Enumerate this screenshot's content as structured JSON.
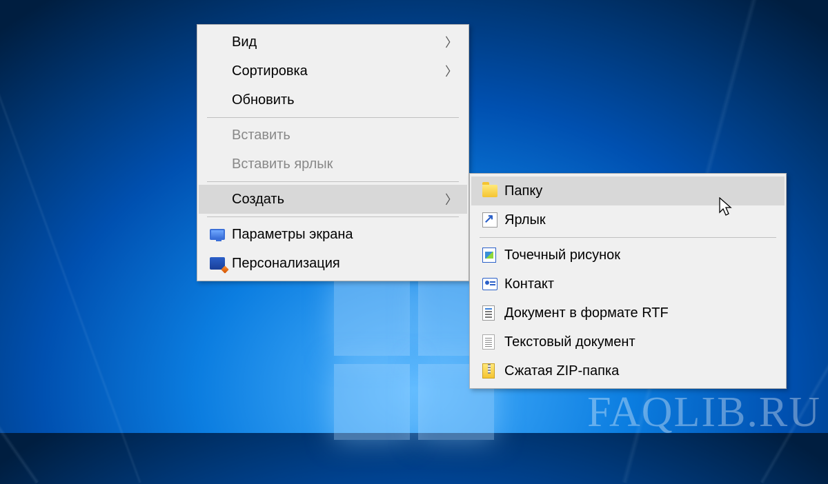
{
  "watermark": "FAQLIB.RU",
  "context_menu": {
    "items": [
      {
        "label": "Вид",
        "has_submenu": true,
        "icon": null,
        "disabled": false
      },
      {
        "label": "Сортировка",
        "has_submenu": true,
        "icon": null,
        "disabled": false
      },
      {
        "label": "Обновить",
        "has_submenu": false,
        "icon": null,
        "disabled": false
      },
      {
        "separator": true
      },
      {
        "label": "Вставить",
        "has_submenu": false,
        "icon": null,
        "disabled": true
      },
      {
        "label": "Вставить ярлык",
        "has_submenu": false,
        "icon": null,
        "disabled": true
      },
      {
        "separator": true
      },
      {
        "label": "Создать",
        "has_submenu": true,
        "icon": null,
        "disabled": false,
        "highlighted": true
      },
      {
        "separator": true
      },
      {
        "label": "Параметры экрана",
        "has_submenu": false,
        "icon": "screen",
        "disabled": false
      },
      {
        "label": "Персонализация",
        "has_submenu": false,
        "icon": "personalize",
        "disabled": false
      }
    ]
  },
  "submenu": {
    "items": [
      {
        "label": "Папку",
        "icon": "folder",
        "highlighted": true
      },
      {
        "label": "Ярлык",
        "icon": "shortcut"
      },
      {
        "separator": true
      },
      {
        "label": "Точечный рисунок",
        "icon": "bmp"
      },
      {
        "label": "Контакт",
        "icon": "contact"
      },
      {
        "label": "Документ в формате RTF",
        "icon": "rtf"
      },
      {
        "label": "Текстовый документ",
        "icon": "txt"
      },
      {
        "label": "Сжатая ZIP-папка",
        "icon": "zip"
      }
    ]
  }
}
